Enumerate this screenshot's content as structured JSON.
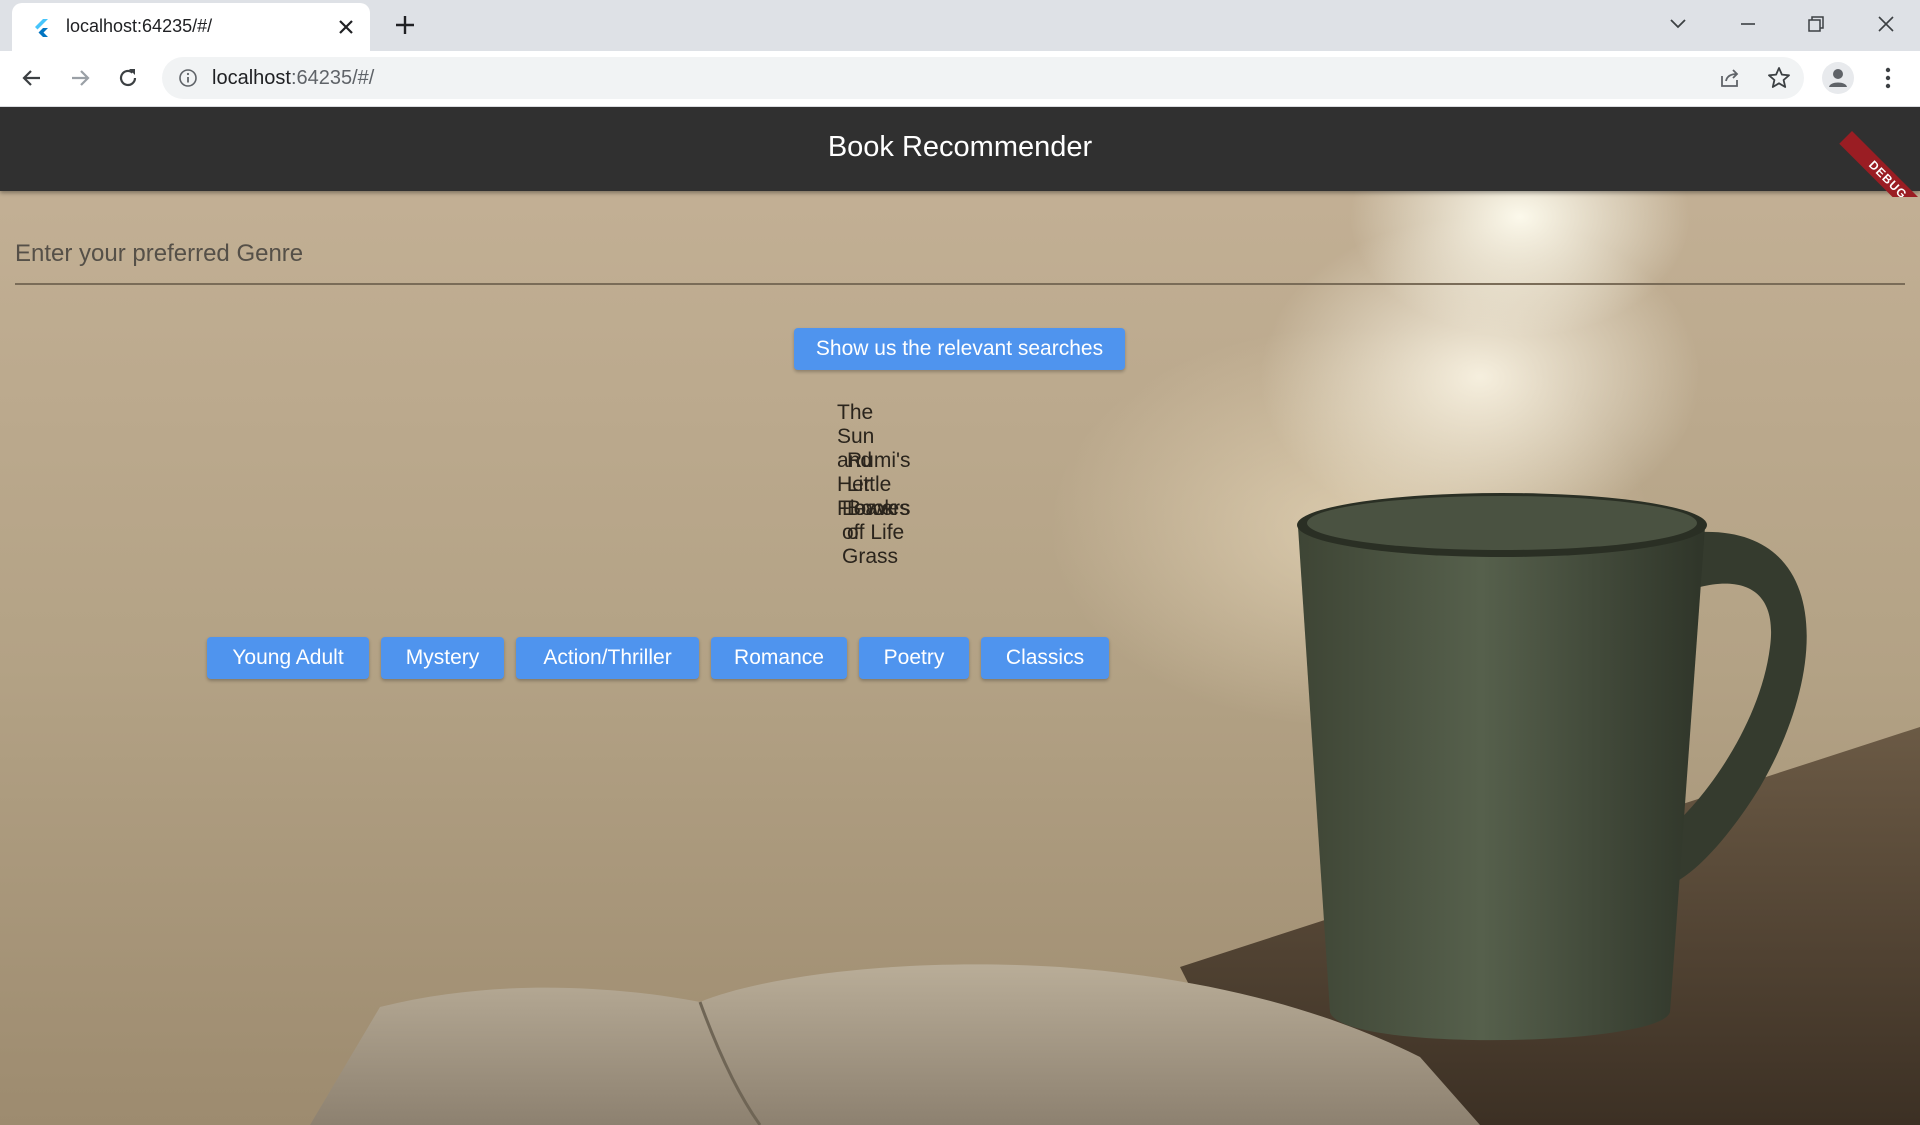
{
  "browser": {
    "tab_title": "localhost:64235/#/",
    "url_host": "localhost",
    "url_rest": ":64235/#/",
    "icons": {
      "favicon": "flutter-icon",
      "tab_close": "close-icon",
      "new_tab": "plus-icon",
      "tab_search": "chevron-down-icon",
      "minimize": "minimize-icon",
      "restore": "restore-icon",
      "close_window": "close-icon",
      "back": "arrow-back-icon",
      "forward": "arrow-forward-icon",
      "reload": "reload-icon",
      "site_info": "info-icon",
      "share": "share-icon",
      "bookmark": "star-icon",
      "profile": "avatar-icon",
      "menu": "more-vert-icon"
    }
  },
  "app": {
    "title": "Book Recommender",
    "debug_label": "DEBUG",
    "genre_placeholder": "Enter your preferred Genre",
    "search_button": "Show us the relevant searches",
    "results": [
      "The Sun and Her Flowers",
      "Rumi's Little Book of Life",
      "Leaves of Grass"
    ],
    "genre_buttons": [
      "Young Adult",
      "Mystery",
      "Action/Thriller",
      "Romance",
      "Poetry",
      "Classics"
    ],
    "colors": {
      "appbar": "#303030",
      "button": "#4f94ee",
      "debug_ribbon": "#9a1d23"
    }
  }
}
